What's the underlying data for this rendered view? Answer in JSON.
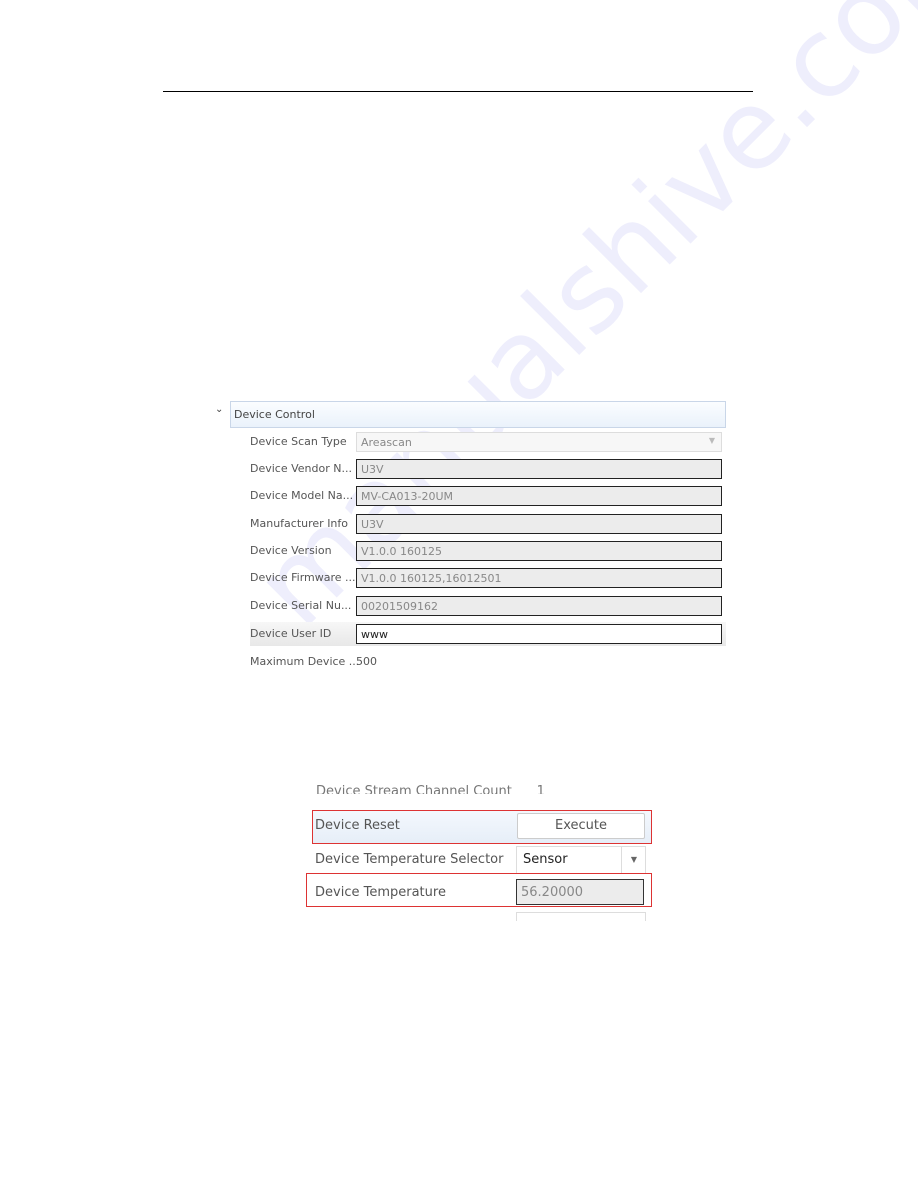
{
  "panel1": {
    "section_title": "Device Control",
    "rows": [
      {
        "label": "Device Scan Type",
        "value": "Areascan"
      },
      {
        "label": "Device Vendor N...",
        "value": "U3V"
      },
      {
        "label": "Device Model Na...",
        "value": "MV-CA013-20UM"
      },
      {
        "label": "Manufacturer Info",
        "value": "U3V"
      },
      {
        "label": "Device Version",
        "value": "V1.0.0 160125"
      },
      {
        "label": "Device Firmware ...",
        "value": "V1.0.0 160125,16012501"
      },
      {
        "label": "Device Serial Nu...",
        "value": "00201509162"
      },
      {
        "label": "Device User ID",
        "value": "www"
      },
      {
        "label": "Maximum Device ...",
        "value": "500"
      }
    ]
  },
  "panel2": {
    "reset_label": "Device Reset",
    "execute_button": "Execute",
    "temp_selector_label": "Device Temperature Selector",
    "temp_selector_value": "Sensor",
    "temperature_label": "Device Temperature",
    "temperature_value": "56.20000",
    "highlight_color": "#d33333"
  },
  "watermark": "manualshive.com"
}
